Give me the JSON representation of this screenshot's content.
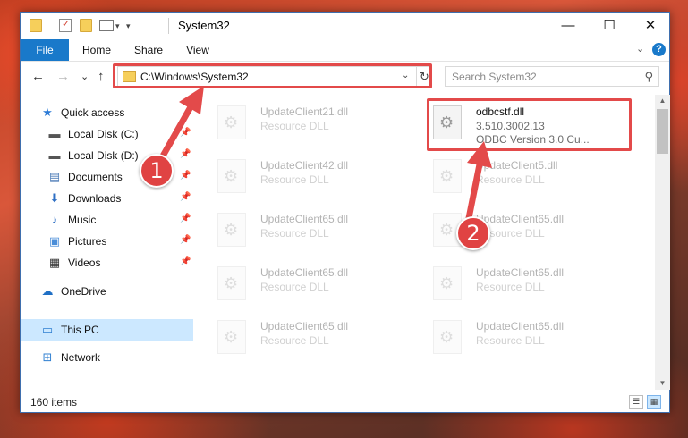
{
  "window": {
    "title": "System32",
    "minimize": "—",
    "maximize": "☐",
    "close": "✕"
  },
  "ribbon": {
    "tabs": [
      "File",
      "Home",
      "Share",
      "View"
    ],
    "expand": "⌄",
    "help": "?"
  },
  "nav": {
    "back": "←",
    "forward": "→",
    "recent": "⌄",
    "up": "↑"
  },
  "address": {
    "path": "C:\\Windows\\System32",
    "dropdown": "⌄",
    "refresh": "↻"
  },
  "search": {
    "placeholder": "Search System32",
    "icon": "search-icon"
  },
  "sidebar": {
    "items": [
      {
        "label": "Quick access",
        "icon": "star-icon",
        "pinned": false
      },
      {
        "label": "Local Disk (C:)",
        "icon": "drive-icon",
        "pinned": true
      },
      {
        "label": "Local Disk (D:)",
        "icon": "drive-icon",
        "pinned": true
      },
      {
        "label": "Documents",
        "icon": "documents-icon",
        "pinned": true
      },
      {
        "label": "Downloads",
        "icon": "download-icon",
        "pinned": true
      },
      {
        "label": "Music",
        "icon": "music-icon",
        "pinned": true
      },
      {
        "label": "Pictures",
        "icon": "pictures-icon",
        "pinned": true
      },
      {
        "label": "Videos",
        "icon": "videos-icon",
        "pinned": true
      },
      {
        "label": "OneDrive",
        "icon": "cloud-icon",
        "pinned": false
      },
      {
        "label": "This PC",
        "icon": "computer-icon",
        "pinned": false,
        "selected": true
      },
      {
        "label": "Network",
        "icon": "network-icon",
        "pinned": false
      }
    ]
  },
  "files": [
    {
      "name": "UpdateClient21.dll",
      "type": "Resource DLL"
    },
    {
      "name": "odbcstf.dll",
      "version": "3.510.3002.13",
      "description": "ODBC Version 3.0 Cu..."
    },
    {
      "name": "UpdateClient42.dll",
      "type": "Resource DLL"
    },
    {
      "name": "UpdateClient5.dll",
      "type": "Resource DLL"
    },
    {
      "name": "UpdateClient65.dll",
      "type": "Resource DLL"
    },
    {
      "name": "UpdateClient65.dll",
      "type": "Resource DLL"
    },
    {
      "name": "UpdateClient65.dll",
      "type": "Resource DLL"
    },
    {
      "name": "UpdateClient65.dll",
      "type": "Resource DLL"
    },
    {
      "name": "UpdateClient65.dll",
      "type": "Resource DLL"
    },
    {
      "name": "UpdateClient65.dll",
      "type": "Resource DLL"
    }
  ],
  "status": {
    "item_count": "160 items"
  },
  "annotations": {
    "step1": "1",
    "step2": "2",
    "color": "#e34a4a"
  }
}
